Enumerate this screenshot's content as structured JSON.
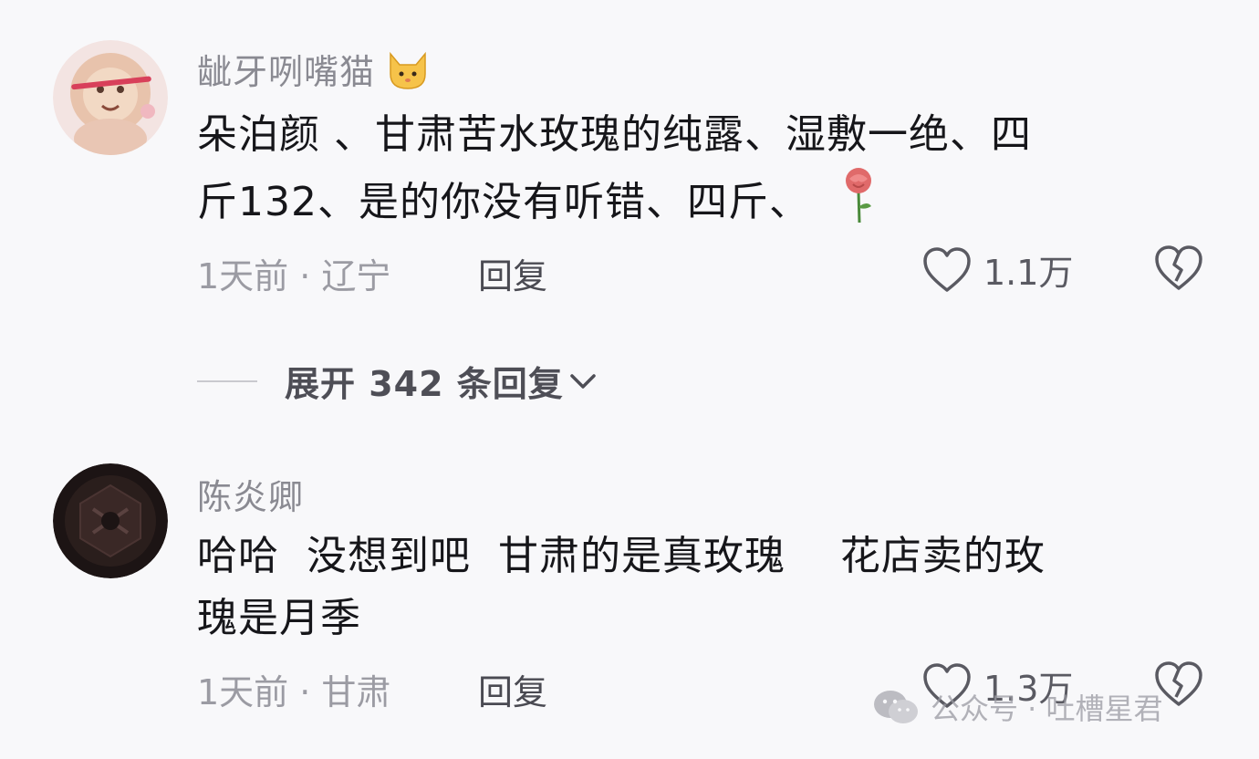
{
  "comments": [
    {
      "username": "龇牙咧嘴猫",
      "username_emoji": "cat-face-emoji",
      "text_line1": "朵泊颜 、甘肃苦水玫瑰的纯露、湿敷一绝、四",
      "text_line2": "斤132、是的你没有听错、四斤、",
      "text_emoji": "rose-emoji",
      "time_location": "1天前 · 辽宁",
      "reply_label": "回复",
      "likes": "1.1万"
    },
    {
      "username": "陈炎卿",
      "text_line1": "哈哈  没想到吧  甘肃的是真玫瑰    花店卖的玫",
      "text_line2": "瑰是月季",
      "time_location": "1天前 · 甘肃",
      "reply_label": "回复",
      "likes": "1.3万"
    }
  ],
  "expand_replies": {
    "label": "展开 342 条回复"
  },
  "watermark": {
    "text": "公众号 · 吐槽星君",
    "icon": "wechat-icon"
  },
  "colors": {
    "background": "#f8f8fa",
    "text_primary": "#16161a",
    "text_secondary": "#9b9ba3"
  }
}
